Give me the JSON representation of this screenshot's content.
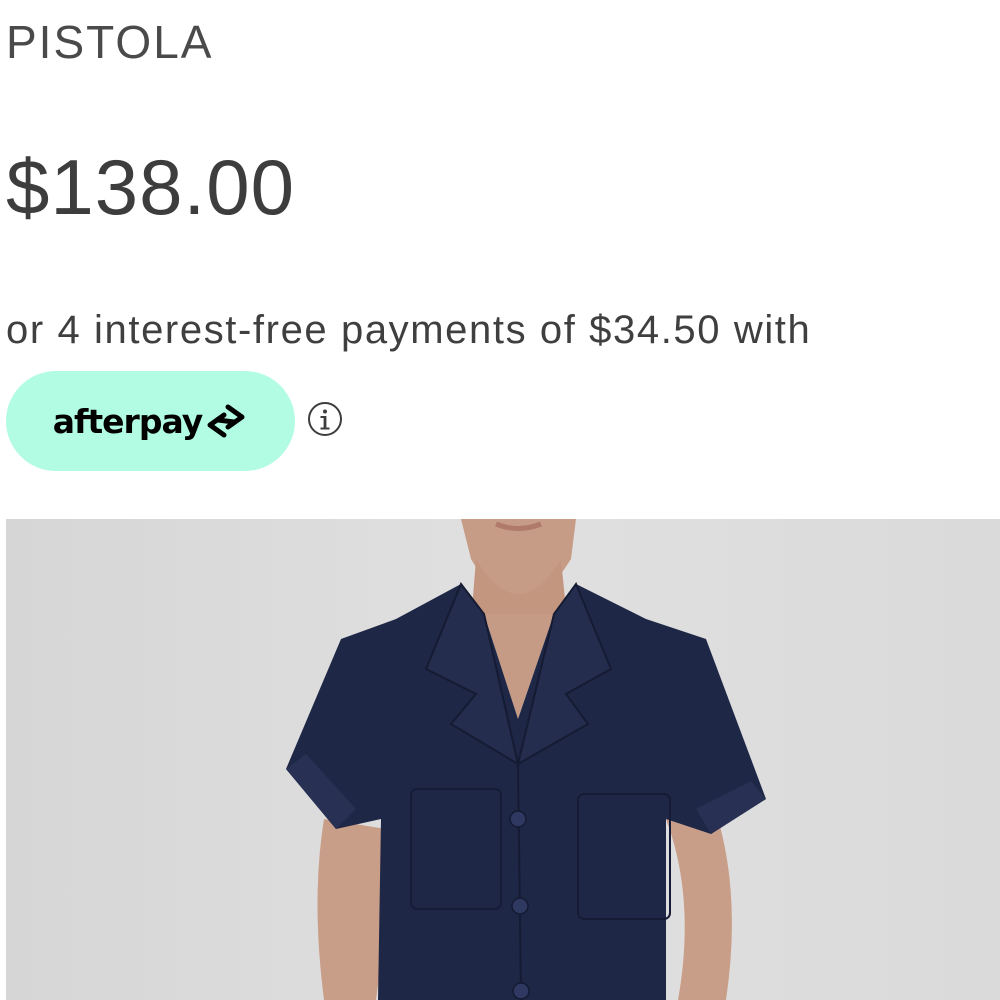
{
  "product": {
    "brand": "PISTOLA",
    "price": "$138.00",
    "installments_text": "or 4 interest-free payments of $34.50 with"
  },
  "afterpay": {
    "wordmark": "afterpay",
    "logo_icon": "afterpay-arrows-icon",
    "info_icon": "info-circle-icon",
    "badge_color": "#b2fce4"
  },
  "image": {
    "background_color": "#dcdcdc",
    "garment_color": "#1f2746",
    "skin_color": "#caa088"
  }
}
